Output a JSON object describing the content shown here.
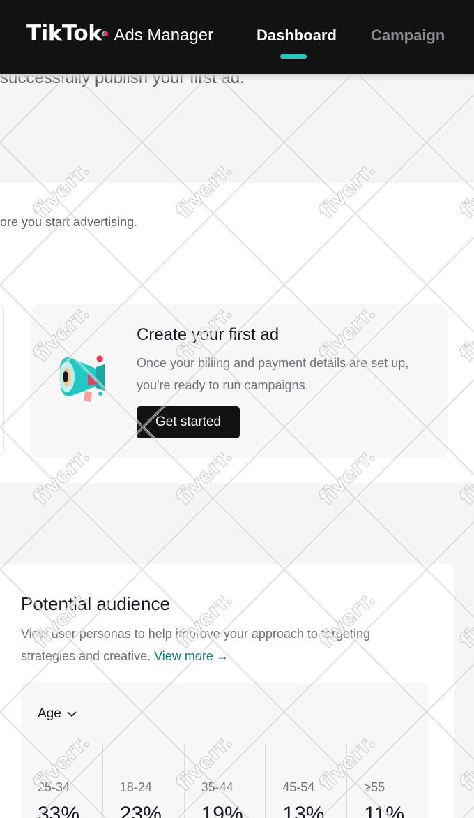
{
  "header": {
    "logo_text": "TikTok",
    "product_name": "Ads Manager",
    "tabs": [
      {
        "label": "Dashboard",
        "active": true
      },
      {
        "label": "Campaign",
        "active": false
      }
    ]
  },
  "intro": {
    "text": "successfully publish your first ad."
  },
  "setup": {
    "hint": "ore you start advertising.",
    "step": {
      "icon": "megaphone-icon",
      "title": "Create your first ad",
      "description": "Once your billing and payment details are set up, you're ready to run campaigns.",
      "button_label": "Get started"
    }
  },
  "audience": {
    "title": "Potential audience",
    "description": "View user personas to help improve your approach to targeting strategies and creative.",
    "link_label": "View more",
    "selector_label": "Age",
    "ages": [
      {
        "range": "25-34",
        "percent": "33%"
      },
      {
        "range": "18-24",
        "percent": "23%"
      },
      {
        "range": "35-44",
        "percent": "19%"
      },
      {
        "range": "45-54",
        "percent": "13%"
      },
      {
        "range": "≥55",
        "percent": "11%"
      }
    ]
  },
  "watermark": {
    "text": "fiverr."
  },
  "colors": {
    "header_bg": "#121212",
    "accent_teal": "#20c9c3",
    "link_teal": "#0f7a7f",
    "page_bg": "#f5f5f5",
    "brand_pink": "#fe2c55",
    "brand_cyan": "#25f4ee"
  }
}
